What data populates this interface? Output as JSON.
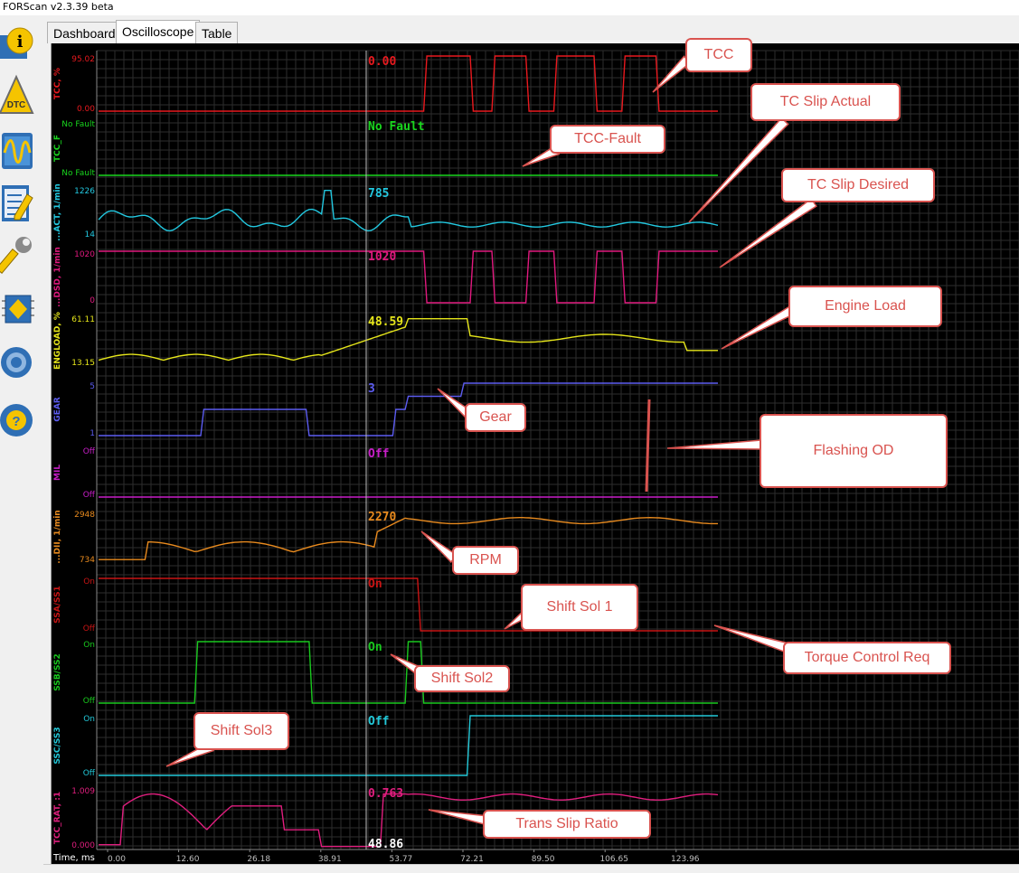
{
  "window": {
    "title": "FORScan v2.3.39 beta"
  },
  "sidebar": {
    "items": [
      {
        "icon": "info-icon",
        "label": "i"
      },
      {
        "icon": "dtc-icon",
        "label": "DTC"
      },
      {
        "icon": "oscilloscope-icon"
      },
      {
        "icon": "checklist-icon"
      },
      {
        "icon": "wrench-icon"
      },
      {
        "icon": "chip-icon"
      },
      {
        "icon": "gear-icon"
      },
      {
        "icon": "help-icon",
        "label": "?"
      }
    ]
  },
  "tabs": [
    {
      "label": "Dashboard",
      "active": false
    },
    {
      "label": "Oscilloscope",
      "active": true
    },
    {
      "label": "Table",
      "active": false
    }
  ],
  "oscilloscope": {
    "cursor_time": "48.86",
    "time_axis": {
      "label": "Time, ms",
      "ticks": [
        "0.00",
        "12.60",
        "26.18",
        "38.91",
        "53.77",
        "72.21",
        "89.50",
        "106.65",
        "123.96"
      ]
    },
    "channels": [
      {
        "name": "TCC, %",
        "color": "#e8191e",
        "max": "95.02",
        "min": "0.00",
        "value": "0.00"
      },
      {
        "name": "TCC_F",
        "color": "#19d61e",
        "max": "No Fault",
        "min": "No Fault",
        "value": "No Fault"
      },
      {
        "name": "...ACT, 1/min",
        "color": "#22c8e0",
        "max": "1226",
        "min": "14",
        "value": "785"
      },
      {
        "name": "...DSD, 1/min",
        "color": "#e0197e",
        "max": "1020",
        "min": "0",
        "value": "1020"
      },
      {
        "name": "ENGLOAD, %",
        "color": "#e6e61a",
        "max": "61.11",
        "min": "13.15",
        "value": "48.59"
      },
      {
        "name": "GEAR",
        "color": "#5c5cf0",
        "max": "5",
        "min": "1",
        "value": "3"
      },
      {
        "name": "MIL",
        "color": "#c81ec8",
        "max": "Off",
        "min": "Off",
        "value": "Off"
      },
      {
        "name": "...DII, 1/min",
        "color": "#e88a1e",
        "max": "2948",
        "min": "734",
        "value": "2270"
      },
      {
        "name": "SSA/SS1",
        "color": "#c81414",
        "max": "On",
        "min": "Off",
        "value": "On"
      },
      {
        "name": "SSB/SS2",
        "color": "#19c81e",
        "max": "On",
        "min": "Off",
        "value": "On"
      },
      {
        "name": "SSC/SS3",
        "color": "#22c8d8",
        "max": "On",
        "min": "Off",
        "value": "Off"
      },
      {
        "name": "TCC_RAT, :1",
        "color": "#e01e7e",
        "max": "1.009",
        "min": "0.000",
        "value": "0.763"
      }
    ]
  },
  "annotations": [
    {
      "text": "TCC"
    },
    {
      "text": "TC Slip Actual"
    },
    {
      "text": "TCC-Fault"
    },
    {
      "text": "TC Slip Desired"
    },
    {
      "text": "Engine Load"
    },
    {
      "text": "Gear"
    },
    {
      "text": "Flashing OD"
    },
    {
      "text": "RPM"
    },
    {
      "text": "Shift Sol 1"
    },
    {
      "text": "Torque Control Req"
    },
    {
      "text": "Shift Sol2"
    },
    {
      "text": "Shift Sol3"
    },
    {
      "text": "Trans Slip Ratio"
    }
  ]
}
